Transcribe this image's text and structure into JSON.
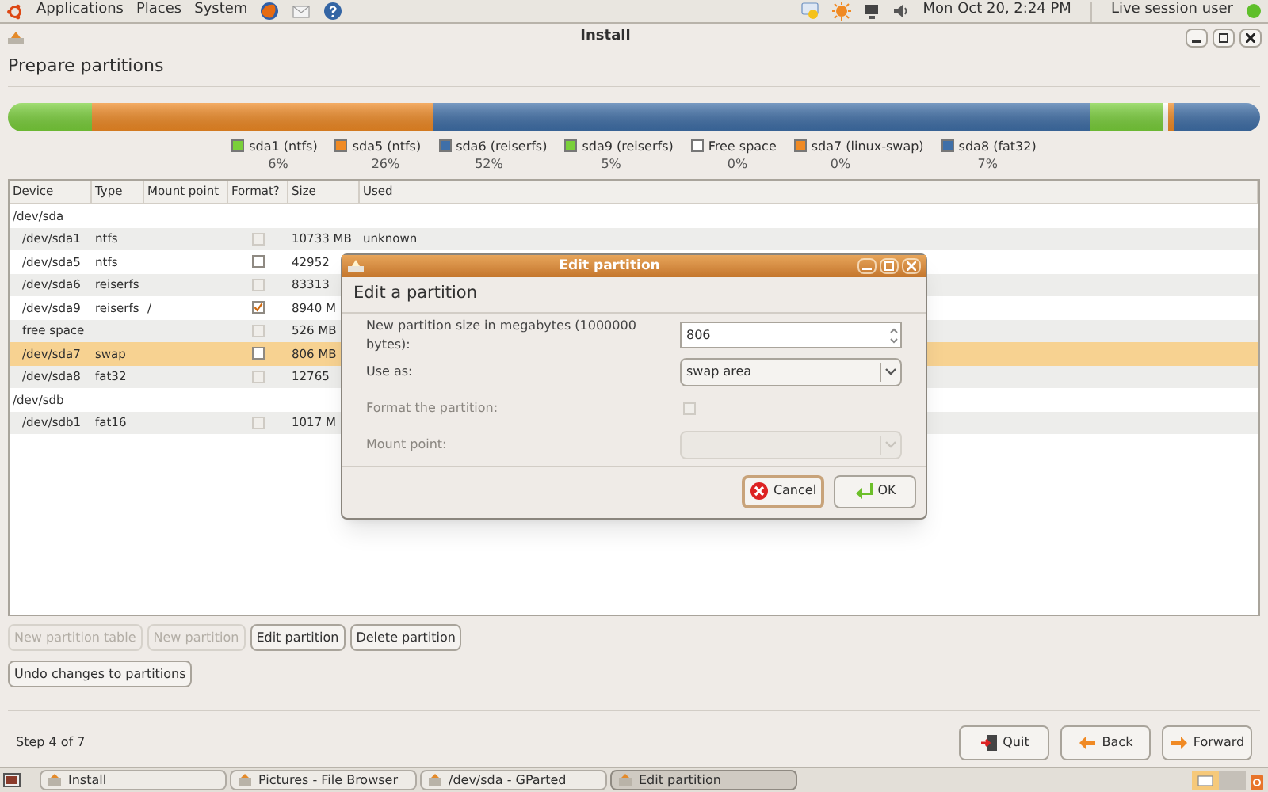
{
  "top_panel": {
    "menus": [
      "Applications",
      "Places",
      "System"
    ],
    "clock": "Mon Oct 20,  2:24 PM",
    "user": "Live session user"
  },
  "window": {
    "title": "Install"
  },
  "heading": "Prepare partitions",
  "partitions_bar": [
    {
      "name": "sda1 (ntfs)",
      "percent": "6%",
      "color": "#7ad03a"
    },
    {
      "name": "sda5 (ntfs)",
      "percent": "26%",
      "color": "#f08a24"
    },
    {
      "name": "sda6 (reiserfs)",
      "percent": "52%",
      "color": "#3f6fa8"
    },
    {
      "name": "sda9 (reiserfs)",
      "percent": "5%",
      "color": "#7ad03a"
    },
    {
      "name": "Free space",
      "percent": "0%",
      "color": "#ffffff"
    },
    {
      "name": "sda7 (linux-swap)",
      "percent": "0%",
      "color": "#f08a24"
    },
    {
      "name": "sda8 (fat32)",
      "percent": "7%",
      "color": "#3f6fa8"
    }
  ],
  "table": {
    "columns": [
      "Device",
      "Type",
      "Mount point",
      "Format?",
      "Size",
      "Used"
    ],
    "rows": [
      {
        "device": "/dev/sda",
        "children": [
          {
            "device": "/dev/sda1",
            "type": "ntfs",
            "format": {
              "checked": false,
              "disabled": true
            },
            "size": "10733 MB",
            "used": "unknown",
            "selected": false
          },
          {
            "device": "/dev/sda5",
            "type": "ntfs",
            "format": {
              "checked": false,
              "disabled": false
            },
            "size": "42952",
            "selected": false
          },
          {
            "device": "/dev/sda6",
            "type": "reiserfs",
            "format": {
              "checked": false,
              "disabled": true
            },
            "size": "83313",
            "selected": false
          },
          {
            "device": "/dev/sda9",
            "type": "reiserfs",
            "mount": "/",
            "format": {
              "checked": true,
              "disabled": false
            },
            "size": "8940 M",
            "selected": false
          },
          {
            "device": "free space",
            "format": {
              "checked": false,
              "disabled": true
            },
            "size": "526 MB",
            "selected": false
          },
          {
            "device": "/dev/sda7",
            "type": "swap",
            "format": {
              "checked": false,
              "disabled": false
            },
            "size": "806 MB",
            "selected": true
          },
          {
            "device": "/dev/sda8",
            "type": "fat32",
            "format": {
              "checked": false,
              "disabled": true
            },
            "size": "12765",
            "selected": false
          }
        ]
      },
      {
        "device": "/dev/sdb",
        "children": [
          {
            "device": "/dev/sdb1",
            "type": "fat16",
            "format": {
              "checked": false,
              "disabled": true
            },
            "size": "1017 M",
            "selected": false
          }
        ]
      }
    ]
  },
  "table_buttons": [
    {
      "label": "New partition table",
      "disabled": true
    },
    {
      "label": "New partition",
      "disabled": true
    },
    {
      "label": "Edit partition",
      "disabled": false
    },
    {
      "label": "Delete partition",
      "disabled": false
    },
    {
      "label": "Undo changes to partitions",
      "disabled": false
    }
  ],
  "step": "Step 4 of 7",
  "nav_buttons": [
    {
      "kind": "quit",
      "label": "Quit"
    },
    {
      "kind": "back",
      "label": "Back"
    },
    {
      "kind": "forward",
      "label": "Forward"
    }
  ],
  "dialog": {
    "title": "Edit partition",
    "heading": "Edit a partition",
    "fields": [
      {
        "kind": "spin",
        "label": "New partition size in megabytes (1000000 bytes):",
        "value": "806"
      },
      {
        "kind": "combo",
        "label": "Use as:",
        "value": "swap area",
        "disabled": false
      },
      {
        "kind": "check",
        "label": "Format the partition:",
        "checked": false,
        "disabled": true
      },
      {
        "kind": "combo",
        "label": "Mount point:",
        "disabled": true
      }
    ],
    "buttons": [
      {
        "kind": "cancel",
        "label": "Cancel",
        "focused": true
      },
      {
        "kind": "ok",
        "label": "OK",
        "focused": false
      }
    ]
  },
  "taskbar": [
    {
      "label": "Install",
      "selected": false
    },
    {
      "label": "Pictures - File Browser",
      "selected": false
    },
    {
      "label": "/dev/sda - GParted",
      "selected": false
    },
    {
      "label": "Edit partition",
      "selected": true
    }
  ]
}
